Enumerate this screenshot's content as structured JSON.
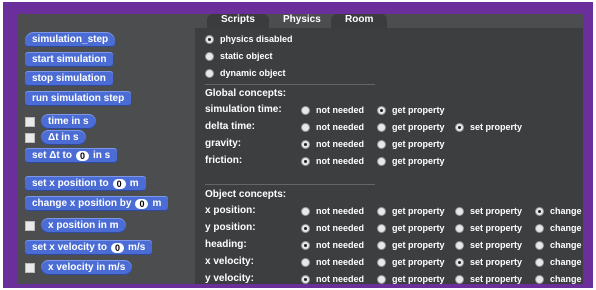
{
  "palette": {
    "simulation_step": "simulation_step",
    "start_simulation": "start simulation",
    "stop_simulation": "stop simulation",
    "run_simulation_step": "run simulation step",
    "time_reporter": "time in s",
    "delta_t_reporter": "Δt in s",
    "set_dt": {
      "prefix": "set Δt to",
      "value": "0",
      "suffix": "in s"
    },
    "set_x_position": {
      "prefix": "set x position to",
      "value": "0",
      "suffix": "m"
    },
    "change_x_position": {
      "prefix": "change x position by",
      "value": "0",
      "suffix": "m"
    },
    "x_position_reporter": "x position in m",
    "set_x_velocity": {
      "prefix": "set x velocity to",
      "value": "0",
      "suffix": "m/s"
    },
    "x_velocity_reporter": "x velocity in m/s"
  },
  "tabs": [
    "Scripts",
    "Physics",
    "Room"
  ],
  "active_tab": "Physics",
  "physics_mode": {
    "options": [
      "physics disabled",
      "static object",
      "dynamic object"
    ],
    "selected": "physics disabled"
  },
  "global": {
    "title": "Global concepts:",
    "rows": [
      {
        "label": "simulation time:",
        "options": [
          "not needed",
          "get property"
        ],
        "selected": "get property"
      },
      {
        "label": "delta time:",
        "options": [
          "not needed",
          "get property",
          "set property"
        ],
        "selected": "set property"
      },
      {
        "label": "gravity:",
        "options": [
          "not needed",
          "get property"
        ],
        "selected": "not needed"
      },
      {
        "label": "friction:",
        "options": [
          "not needed",
          "get property"
        ],
        "selected": "not needed"
      }
    ]
  },
  "object": {
    "title": "Object concepts:",
    "rows": [
      {
        "label": "x position:",
        "options": [
          "not needed",
          "get property",
          "set property",
          "change"
        ],
        "selected": "change"
      },
      {
        "label": "y position:",
        "options": [
          "not needed",
          "get property",
          "set property",
          "change"
        ],
        "selected": "not needed"
      },
      {
        "label": "heading:",
        "options": [
          "not needed",
          "get property",
          "set property",
          "change"
        ],
        "selected": "not needed"
      },
      {
        "label": "x velocity:",
        "options": [
          "not needed",
          "get property",
          "set property",
          "change"
        ],
        "selected": "set property"
      },
      {
        "label": "y velocity:",
        "options": [
          "not needed",
          "get property",
          "set property",
          "change"
        ],
        "selected": "not needed"
      }
    ]
  }
}
